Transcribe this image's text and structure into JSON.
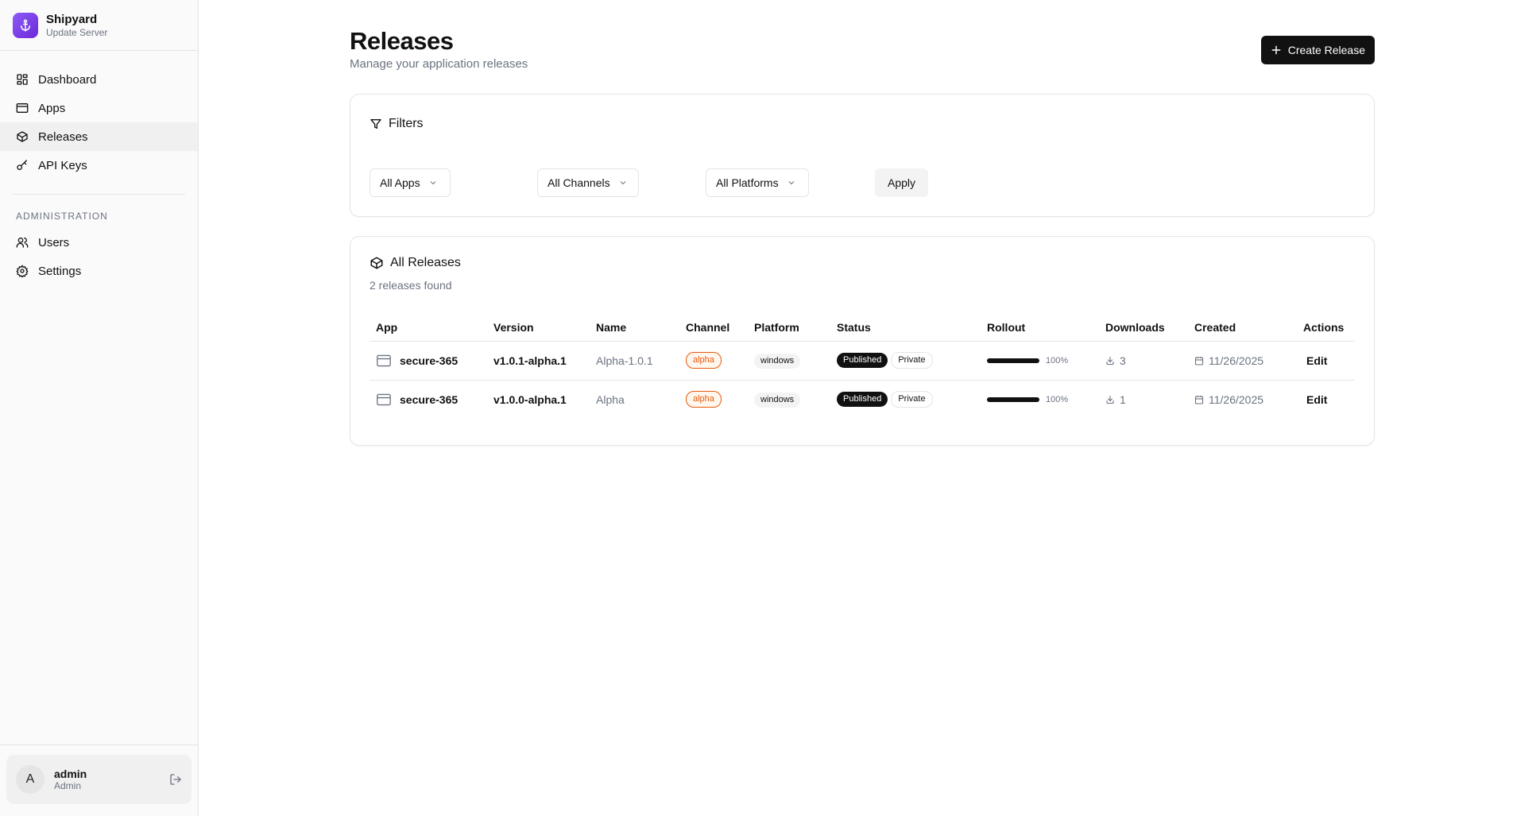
{
  "brand": {
    "name": "Shipyard",
    "subtitle": "Update Server",
    "accent": "#7c3aed"
  },
  "sidebar": {
    "items": [
      {
        "label": "Dashboard",
        "icon": "grid-icon"
      },
      {
        "label": "Apps",
        "icon": "window-icon"
      },
      {
        "label": "Releases",
        "icon": "package-icon",
        "active": true
      },
      {
        "label": "API Keys",
        "icon": "key-icon"
      }
    ],
    "admin_section": "ADMINISTRATION",
    "admin_items": [
      {
        "label": "Users",
        "icon": "users-icon"
      },
      {
        "label": "Settings",
        "icon": "gear-icon"
      }
    ]
  },
  "user": {
    "initial": "A",
    "name": "admin",
    "role": "Admin"
  },
  "header": {
    "title": "Releases",
    "subtitle": "Manage your application releases",
    "create_label": "Create Release"
  },
  "filters": {
    "title": "Filters",
    "apps": "All Apps",
    "channels": "All Channels",
    "platforms": "All Platforms",
    "apply_label": "Apply"
  },
  "releases": {
    "title": "All Releases",
    "count_text": "2 releases found",
    "columns": [
      "App",
      "Version",
      "Name",
      "Channel",
      "Platform",
      "Status",
      "Rollout",
      "Downloads",
      "Created",
      "Actions"
    ],
    "rows": [
      {
        "app": "secure-365",
        "version": "v1.0.1-alpha.1",
        "name": "Alpha-1.0.1",
        "channel": "alpha",
        "platform": "windows",
        "status": "Published",
        "visibility": "Private",
        "rollout": 100,
        "rollout_text": "100%",
        "downloads": "3",
        "created": "11/26/2025",
        "action": "Edit"
      },
      {
        "app": "secure-365",
        "version": "v1.0.0-alpha.1",
        "name": "Alpha",
        "channel": "alpha",
        "platform": "windows",
        "status": "Published",
        "visibility": "Private",
        "rollout": 100,
        "rollout_text": "100%",
        "downloads": "1",
        "created": "11/26/2025",
        "action": "Edit"
      }
    ]
  }
}
